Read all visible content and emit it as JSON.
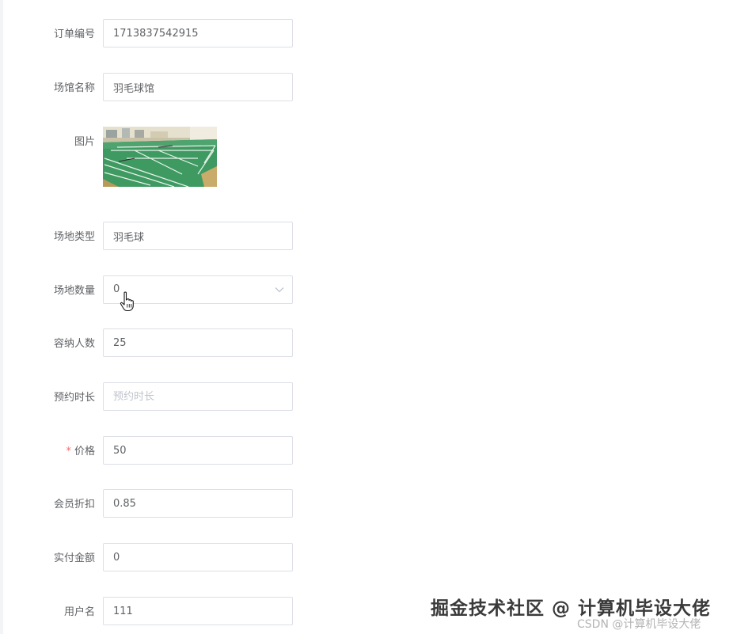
{
  "form": {
    "order_no": {
      "label": "订单编号",
      "value": "1713837542915"
    },
    "venue_name": {
      "label": "场馆名称",
      "value": "羽毛球馆"
    },
    "picture": {
      "label": "图片"
    },
    "field_type": {
      "label": "场地类型",
      "value": "羽毛球"
    },
    "field_count": {
      "label": "场地数量",
      "value": "0"
    },
    "capacity": {
      "label": "容纳人数",
      "value": "25"
    },
    "duration": {
      "label": "预约时长",
      "placeholder": "预约时长"
    },
    "price": {
      "required_mark": "*",
      "label": "价格",
      "value": "50"
    },
    "member_discount": {
      "label": "会员折扣",
      "value": "0.85"
    },
    "paid_amount": {
      "label": "实付金额",
      "value": "0"
    },
    "username": {
      "label": "用户名",
      "value": "111"
    }
  },
  "watermark": {
    "main": "掘金技术社区 @ 计算机毕设大佬",
    "sub": "CSDN @计算机毕设大佬"
  },
  "colors": {
    "border": "#dcdfe6",
    "label": "#606266",
    "required": "#f56c6c",
    "placeholder": "#c0c4cc"
  },
  "icons": {
    "select_arrow": "chevron-down-icon",
    "pointer": "hand-cursor-icon"
  }
}
